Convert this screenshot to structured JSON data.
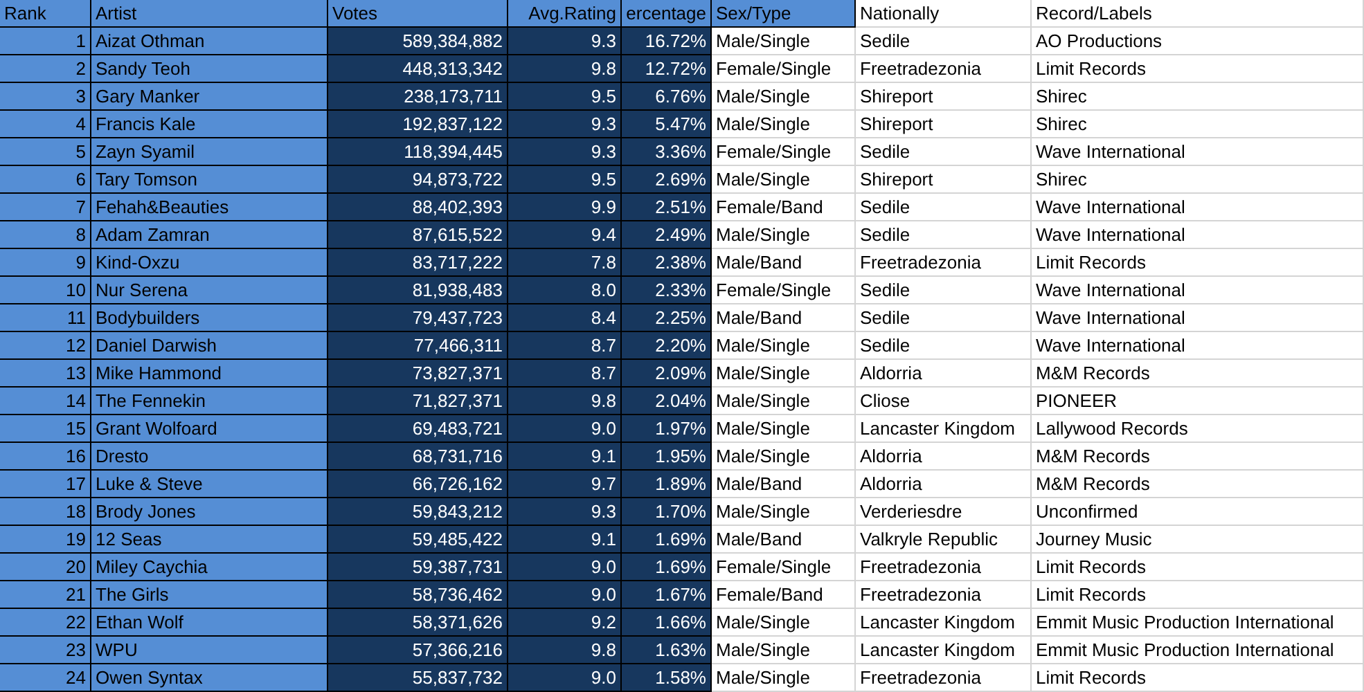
{
  "table": {
    "columns": [
      {
        "label": "Rank",
        "kind": "rank"
      },
      {
        "label": "Artist",
        "kind": "blue"
      },
      {
        "label": "Votes",
        "kind": "navy"
      },
      {
        "label": "Avg.Rating",
        "kind": "navy"
      },
      {
        "label": "ercentage",
        "kind": "navy"
      },
      {
        "label": "Sex/Type",
        "kind": "mixed"
      },
      {
        "label": "Nationally",
        "kind": "plain"
      },
      {
        "label": "Record/Labels",
        "kind": "plain"
      }
    ],
    "rows": [
      [
        "1",
        "Aizat Othman",
        "589,384,882",
        "9.3",
        "16.72%",
        "Male/Single",
        "Sedile",
        "AO Productions"
      ],
      [
        "2",
        "Sandy Teoh",
        "448,313,342",
        "9.8",
        "12.72%",
        "Female/Single",
        "Freetradezonia",
        "Limit Records"
      ],
      [
        "3",
        "Gary Manker",
        "238,173,711",
        "9.5",
        "6.76%",
        "Male/Single",
        "Shireport",
        "Shirec"
      ],
      [
        "4",
        "Francis Kale",
        "192,837,122",
        "9.3",
        "5.47%",
        "Male/Single",
        "Shireport",
        "Shirec"
      ],
      [
        "5",
        "Zayn Syamil",
        "118,394,445",
        "9.3",
        "3.36%",
        "Female/Single",
        "Sedile",
        "Wave International"
      ],
      [
        "6",
        "Tary Tomson",
        "94,873,722",
        "9.5",
        "2.69%",
        "Male/Single",
        "Shireport",
        "Shirec"
      ],
      [
        "7",
        "Fehah&Beauties",
        "88,402,393",
        "9.9",
        "2.51%",
        "Female/Band",
        "Sedile",
        "Wave International"
      ],
      [
        "8",
        "Adam Zamran",
        "87,615,522",
        "9.4",
        "2.49%",
        "Male/Single",
        "Sedile",
        "Wave International"
      ],
      [
        "9",
        "Kind-Oxzu",
        "83,717,222",
        "7.8",
        "2.38%",
        "Male/Band",
        "Freetradezonia",
        "Limit Records"
      ],
      [
        "10",
        "Nur Serena",
        "81,938,483",
        "8.0",
        "2.33%",
        "Female/Single",
        "Sedile",
        "Wave International"
      ],
      [
        "11",
        "Bodybuilders",
        "79,437,723",
        "8.4",
        "2.25%",
        "Male/Band",
        "Sedile",
        "Wave International"
      ],
      [
        "12",
        "Daniel Darwish",
        "77,466,311",
        "8.7",
        "2.20%",
        "Male/Single",
        "Sedile",
        "Wave International"
      ],
      [
        "13",
        "Mike Hammond",
        "73,827,371",
        "8.7",
        "2.09%",
        "Male/Single",
        "Aldorria",
        "M&M Records"
      ],
      [
        "14",
        "The Fennekin",
        "71,827,371",
        "9.8",
        "2.04%",
        "Male/Single",
        "Cliose",
        "PIONEER"
      ],
      [
        "15",
        "Grant Wolfoard",
        "69,483,721",
        "9.0",
        "1.97%",
        "Male/Single",
        "Lancaster Kingdom",
        "Lallywood Records"
      ],
      [
        "16",
        "Dresto",
        "68,731,716",
        "9.1",
        "1.95%",
        "Male/Single",
        "Aldorria",
        "M&M Records"
      ],
      [
        "17",
        "Luke & Steve",
        "66,726,162",
        "9.7",
        "1.89%",
        "Male/Band",
        "Aldorria",
        "M&M Records"
      ],
      [
        "18",
        "Brody Jones",
        "59,843,212",
        "9.3",
        "1.70%",
        "Male/Single",
        "Verderiesdre",
        "Unconfirmed"
      ],
      [
        "19",
        "12 Seas",
        "59,485,422",
        "9.1",
        "1.69%",
        "Male/Band",
        "Valkryle Republic",
        "Journey Music"
      ],
      [
        "20",
        "Miley Caychia",
        "59,387,731",
        "9.0",
        "1.69%",
        "Female/Single",
        "Freetradezonia",
        "Limit Records"
      ],
      [
        "21",
        "The Girls",
        "58,736,462",
        "9.0",
        "1.67%",
        "Female/Band",
        "Freetradezonia",
        "Limit Records"
      ],
      [
        "22",
        "Ethan Wolf",
        "58,371,626",
        "9.2",
        "1.66%",
        "Male/Single",
        "Lancaster Kingdom",
        "Emmit Music Production International"
      ],
      [
        "23",
        "WPU",
        "57,366,216",
        "9.8",
        "1.63%",
        "Male/Single",
        "Lancaster Kingdom",
        "Emmit Music Production International"
      ],
      [
        "24",
        "Owen Syntax",
        "55,837,732",
        "9.0",
        "1.58%",
        "Male/Single",
        "Freetradezonia",
        "Limit Records"
      ]
    ]
  }
}
